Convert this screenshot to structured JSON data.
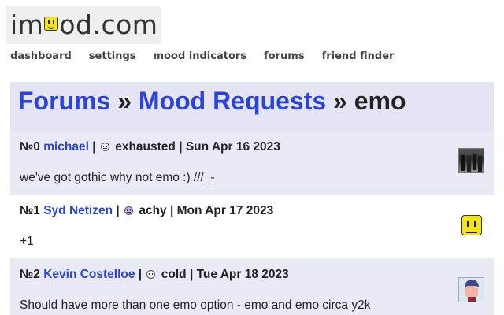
{
  "site": {
    "logo_text_left": "im",
    "logo_text_right": "od.com"
  },
  "nav": {
    "items": [
      "dashboard",
      "settings",
      "mood indicators",
      "forums",
      "friend finder"
    ]
  },
  "title": {
    "forums_link": "Forums",
    "sep1": " » ",
    "section_link": "Mood Requests",
    "sep2": " » ",
    "thread": "emo"
  },
  "posts": [
    {
      "num": "№0",
      "user": "michael",
      "sep": " | ",
      "mood": "exhausted",
      "date": " | Sun Apr 16 2023",
      "text": "we've got gothic why not emo :) ///_-",
      "avatar": "photo-avatar"
    },
    {
      "num": "№1",
      "user": "Syd Netizen",
      "sep": " | ",
      "mood": "achy",
      "date": " | Mon Apr 17 2023",
      "text": "+1",
      "avatar": "smiley-avatar"
    },
    {
      "num": "№2",
      "user": "Kevin Costelloe",
      "sep": " | ",
      "mood": "cold",
      "date": " | Tue Apr 18 2023",
      "text": "Should have more than one emo option - emo and emo circa y2k",
      "avatar": "person-avatar"
    }
  ]
}
